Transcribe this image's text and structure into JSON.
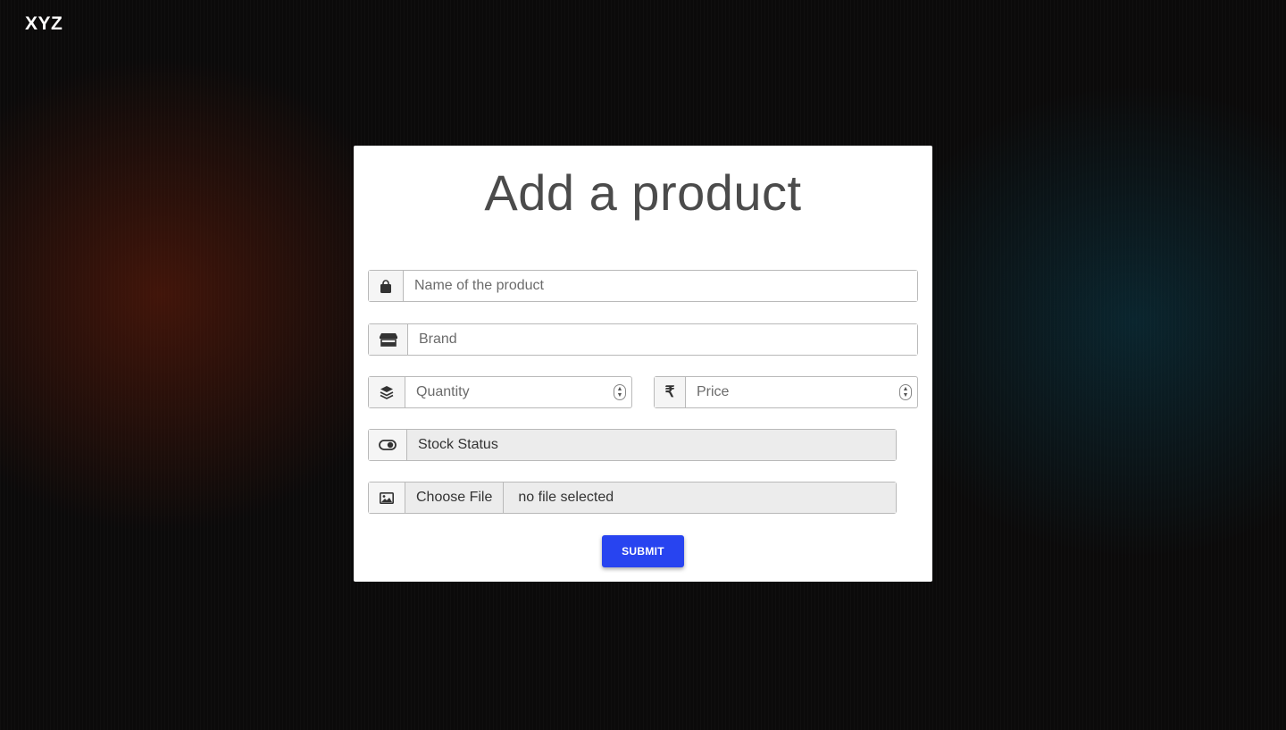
{
  "header": {
    "brand": "XYZ"
  },
  "form": {
    "title": "Add a product",
    "name_placeholder": "Name of the product",
    "brand_placeholder": "Brand",
    "quantity_placeholder": "Quantity",
    "price_placeholder": "Price",
    "stock_status_label": "Stock Status",
    "choose_file_label": "Choose File",
    "file_status": "no file selected",
    "submit_label": "SUBMIT"
  },
  "icons": {
    "name": "shopping-bag-icon",
    "brand": "store-icon",
    "quantity": "layers-icon",
    "price": "rupee-icon",
    "stock": "toggle-icon",
    "image": "image-icon"
  },
  "colors": {
    "accent": "#2844f0",
    "background": "#0b0a0a",
    "card": "#ffffff"
  }
}
